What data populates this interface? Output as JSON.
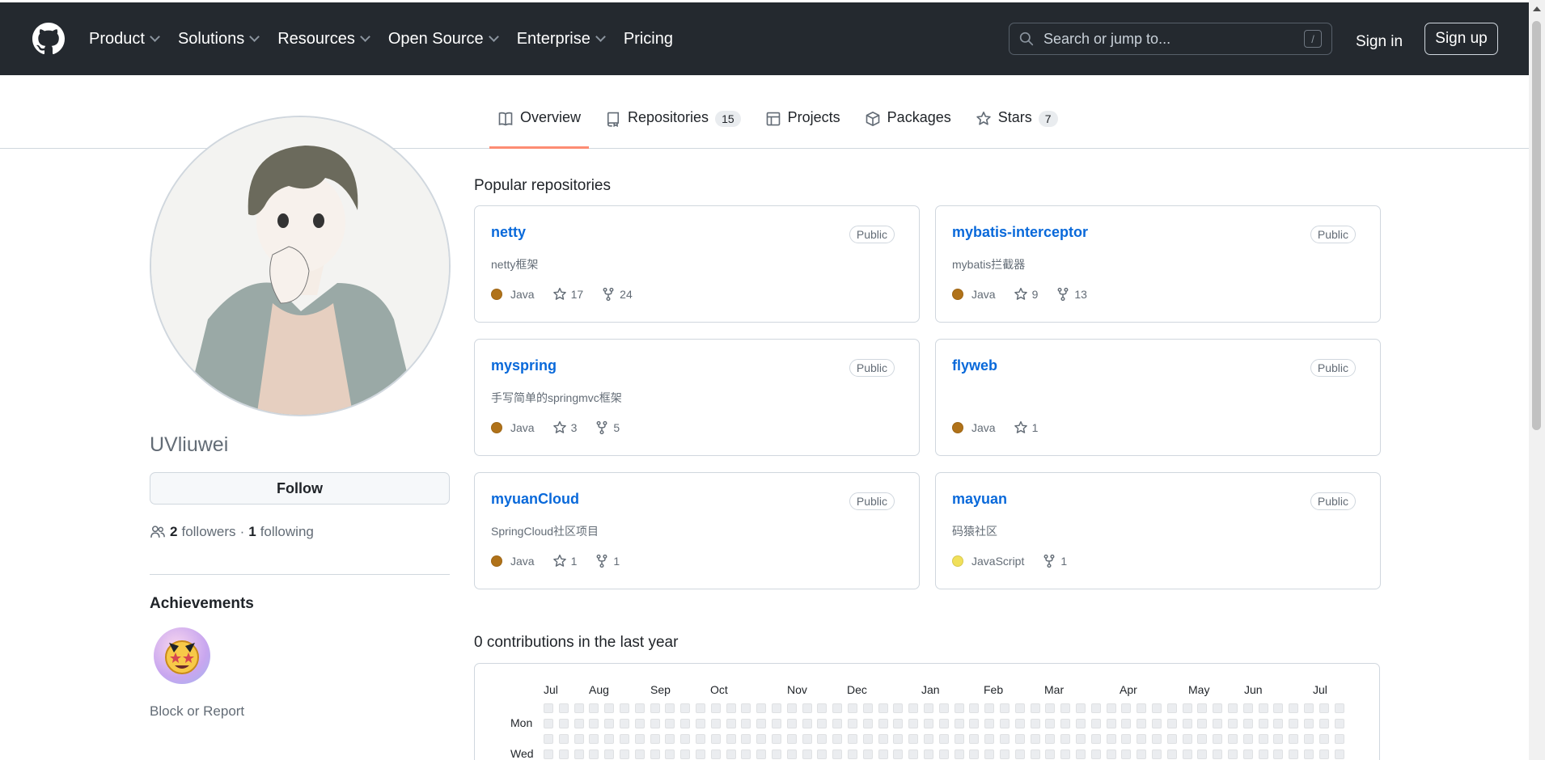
{
  "header": {
    "nav": [
      {
        "label": "Product",
        "has_menu": true
      },
      {
        "label": "Solutions",
        "has_menu": true
      },
      {
        "label": "Resources",
        "has_menu": true
      },
      {
        "label": "Open Source",
        "has_menu": true
      },
      {
        "label": "Enterprise",
        "has_menu": true
      },
      {
        "label": "Pricing",
        "has_menu": false
      }
    ],
    "search_placeholder": "Search or jump to...",
    "search_shortcut": "/",
    "signin": "Sign in",
    "signup": "Sign up"
  },
  "tabs": [
    {
      "label": "Overview",
      "icon": "book-icon",
      "count": null,
      "active": true
    },
    {
      "label": "Repositories",
      "icon": "repo-icon",
      "count": "15",
      "active": false
    },
    {
      "label": "Projects",
      "icon": "table-icon",
      "count": null,
      "active": false
    },
    {
      "label": "Packages",
      "icon": "package-icon",
      "count": null,
      "active": false
    },
    {
      "label": "Stars",
      "icon": "star-icon",
      "count": "7",
      "active": false
    }
  ],
  "profile": {
    "username": "UVliuwei",
    "follow_label": "Follow",
    "followers_count": "2",
    "followers_label": "followers",
    "separator": "·",
    "following_count": "1",
    "following_label": "following",
    "achievements_title": "Achievements",
    "block_report": "Block or Report"
  },
  "popular": {
    "title": "Popular repositories",
    "repos": [
      {
        "name": "netty",
        "visibility": "Public",
        "description": "netty框架",
        "language": "Java",
        "lang_color": "#b07219",
        "stars": "17",
        "forks": "24"
      },
      {
        "name": "mybatis-interceptor",
        "visibility": "Public",
        "description": "mybatis拦截器",
        "language": "Java",
        "lang_color": "#b07219",
        "stars": "9",
        "forks": "13"
      },
      {
        "name": "myspring",
        "visibility": "Public",
        "description": "手写简单的springmvc框架",
        "language": "Java",
        "lang_color": "#b07219",
        "stars": "3",
        "forks": "5"
      },
      {
        "name": "flyweb",
        "visibility": "Public",
        "description": "",
        "language": "Java",
        "lang_color": "#b07219",
        "stars": "1",
        "forks": null
      },
      {
        "name": "myuanCloud",
        "visibility": "Public",
        "description": "SpringCloud社区项目",
        "language": "Java",
        "lang_color": "#b07219",
        "stars": "1",
        "forks": "1"
      },
      {
        "name": "mayuan",
        "visibility": "Public",
        "description": "码猿社区",
        "language": "JavaScript",
        "lang_color": "#f1e05a",
        "stars": null,
        "forks": "1"
      }
    ]
  },
  "contributions": {
    "title": "0 contributions in the last year",
    "months": [
      "Jul",
      "Aug",
      "Sep",
      "Oct",
      "Nov",
      "Dec",
      "Jan",
      "Feb",
      "Mar",
      "Apr",
      "May",
      "Jun",
      "Jul"
    ],
    "day_labels": [
      "Mon",
      "Wed"
    ]
  }
}
